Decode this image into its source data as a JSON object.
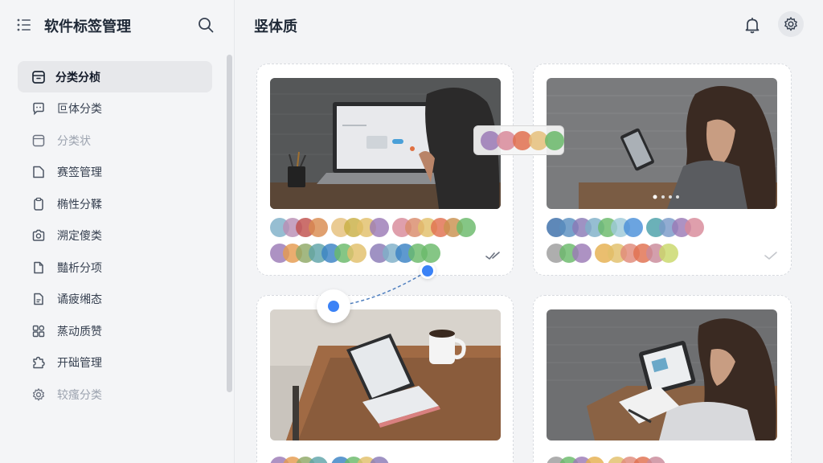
{
  "sidebar": {
    "title": "软件标签管理",
    "items": [
      {
        "label": "分类分桢",
        "icon": "folder-box-icon",
        "active": true
      },
      {
        "label": "叵体分类",
        "icon": "chat-bubble-icon"
      },
      {
        "label": "分类状",
        "icon": "square-icon",
        "dim": true
      },
      {
        "label": "赛签管理",
        "icon": "folder-icon"
      },
      {
        "label": "椭性分鞣",
        "icon": "clipboard-icon"
      },
      {
        "label": "溯定傻类",
        "icon": "camera-icon"
      },
      {
        "label": "豔析分项",
        "icon": "document-icon"
      },
      {
        "label": "谲疲缃态",
        "icon": "file-text-icon"
      },
      {
        "label": "蒸动质赞",
        "icon": "widgets-icon"
      },
      {
        "label": "开础管理",
        "icon": "puzzle-icon"
      },
      {
        "label": "较瘙分类",
        "icon": "cog-icon",
        "dim": true
      }
    ]
  },
  "main": {
    "title": "竖体质"
  },
  "colors": {
    "accent": "#3b82f6",
    "swatches_card1_row1": [
      "#7fb0c8",
      "#b98fb5",
      "#c0504d",
      "#d98b4f",
      "#e5c07b",
      "#c9b046",
      "#e2c06a",
      "#9b7ab6",
      "#d88a9a",
      "#d98b6b",
      "#e2c06a",
      "#e0704f",
      "#c9914f",
      "#6ab96a"
    ],
    "swatches_card1_row2": [
      "#9b7ab6",
      "#e59b4f",
      "#8fa866",
      "#5fa4a8",
      "#3b82c4",
      "#6ab96a",
      "#e2c06a",
      "#8a7ab6",
      "#7fb0c8",
      "#3b82c4",
      "#6ab96a",
      "#6ab96a"
    ],
    "swatches_card2_row1": [
      "#3b6ea8",
      "#5a8fc0",
      "#8a7ab6",
      "#7fb0c8",
      "#6ab96a",
      "#9ec9d8",
      "#4a90d9",
      "#4aa0a8",
      "#7a9ac8",
      "#9b7ab6",
      "#d88a9a"
    ],
    "swatches_card2_row2": [
      "#9c9c9c",
      "#6ab96a",
      "#9b7ab6",
      "#e5b04f",
      "#e2c06a",
      "#e08a7a",
      "#e0704f",
      "#c98a9a",
      "#c9d86a"
    ],
    "floating_chips": [
      "#9b7ab6",
      "#d88a9a",
      "#e0704f",
      "#e5c07b",
      "#6ab96a"
    ]
  }
}
